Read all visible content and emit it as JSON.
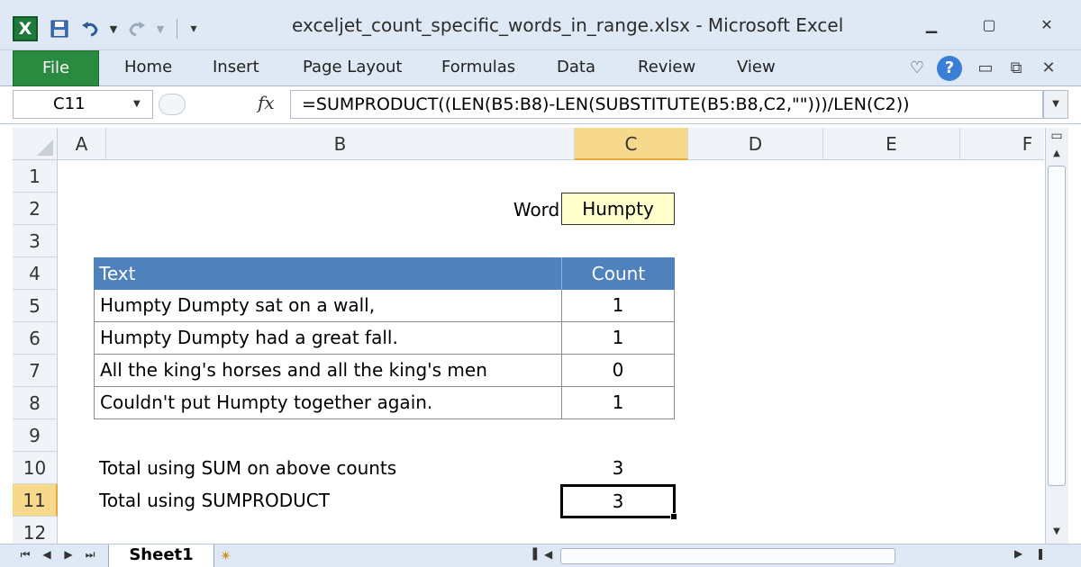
{
  "window": {
    "title": "exceljet_count_specific_words_in_range.xlsx  -  Microsoft Excel",
    "app_icon": "X",
    "min": "▭",
    "restore": "▢",
    "close": "✕"
  },
  "ribbon": {
    "tabs": [
      {
        "label": "File"
      },
      {
        "label": "Home"
      },
      {
        "label": "Insert"
      },
      {
        "label": "Page Layout"
      },
      {
        "label": "Formulas"
      },
      {
        "label": "Data"
      },
      {
        "label": "Review"
      },
      {
        "label": "View"
      }
    ],
    "help": "?"
  },
  "formula_bar": {
    "name_box": "C11",
    "formula": "=SUMPRODUCT((LEN(B5:B8)-LEN(SUBSTITUTE(B5:B8,C2,\"\")))/LEN(C2))"
  },
  "columns": [
    "A",
    "B",
    "C",
    "D",
    "E",
    "F"
  ],
  "rows": [
    "1",
    "2",
    "3",
    "4",
    "5",
    "6",
    "7",
    "8",
    "9",
    "10",
    "11",
    "12"
  ],
  "cells": {
    "word_label": "Word:",
    "word_value": "Humpty",
    "table_header": {
      "text": "Text",
      "count": "Count"
    },
    "table_rows": [
      {
        "text": "Humpty Dumpty sat on a wall,",
        "count": "1"
      },
      {
        "text": "Humpty Dumpty had a great fall.",
        "count": "1"
      },
      {
        "text": "All the king's horses and all the king's men",
        "count": "0"
      },
      {
        "text": "Couldn't put Humpty together again.",
        "count": "1"
      }
    ],
    "total_sum_label": "Total using SUM on above counts",
    "total_sum_value": "3",
    "total_sp_label": "Total using SUMPRODUCT",
    "total_sp_value": "3"
  },
  "sheets": {
    "active": "Sheet1"
  },
  "colors": {
    "header_blue": "#4f81bd",
    "input_yellow": "#ffffcc",
    "selection_orange": "#f6d98a",
    "file_green": "#2a8a3f"
  }
}
